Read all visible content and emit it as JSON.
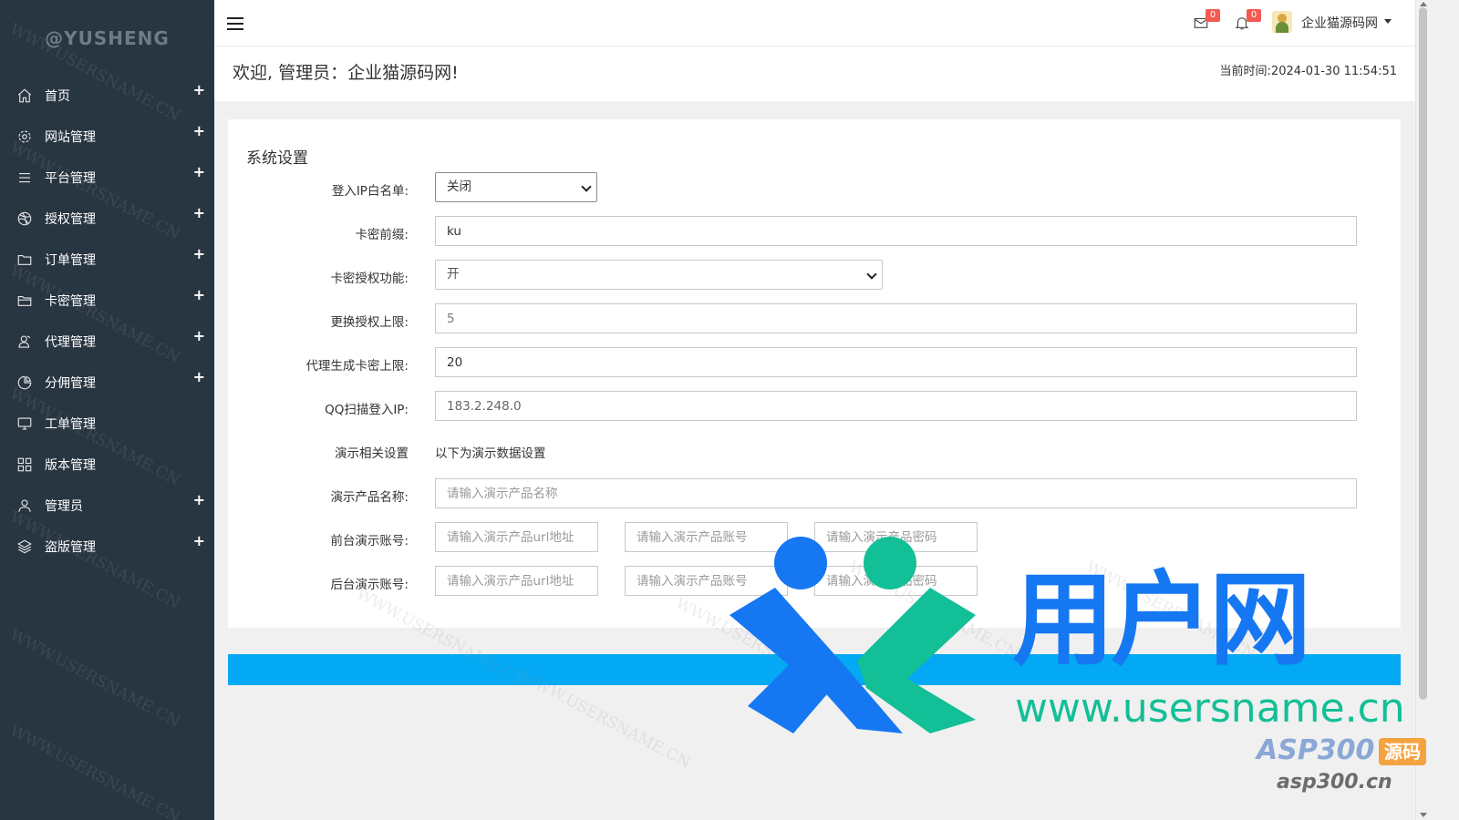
{
  "sidebar": {
    "brand": "@YUSHENG",
    "items": [
      {
        "label": "首页",
        "icon": "home-icon",
        "expandable": true
      },
      {
        "label": "网站管理",
        "icon": "gear-icon",
        "expandable": true
      },
      {
        "label": "平台管理",
        "icon": "list-icon",
        "expandable": true
      },
      {
        "label": "授权管理",
        "icon": "dribbble-icon",
        "expandable": true
      },
      {
        "label": "订单管理",
        "icon": "folder-icon",
        "expandable": true
      },
      {
        "label": "卡密管理",
        "icon": "folder-open-icon",
        "expandable": true
      },
      {
        "label": "代理管理",
        "icon": "agent-icon",
        "expandable": true
      },
      {
        "label": "分佣管理",
        "icon": "pie-chart-icon",
        "expandable": true
      },
      {
        "label": "工单管理",
        "icon": "monitor-icon",
        "expandable": false
      },
      {
        "label": "版本管理",
        "icon": "grid-icon",
        "expandable": false
      },
      {
        "label": "管理员",
        "icon": "user-icon",
        "expandable": true
      },
      {
        "label": "盗版管理",
        "icon": "layers-icon",
        "expandable": true
      }
    ],
    "expand_symbol": "+"
  },
  "topbar": {
    "mail_count": "0",
    "notice_count": "0",
    "username": "企业猫源码网"
  },
  "welcome": {
    "title": "欢迎, 管理员：企业猫源码网!",
    "time": "当前时间:2024-01-30 11:54:51"
  },
  "form": {
    "title": "系统设置",
    "ip_whitelist": {
      "label": "登入IP白名单:",
      "value": "关闭"
    },
    "card_prefix": {
      "label": "卡密前缀:",
      "value": "ku"
    },
    "card_auth": {
      "label": "卡密授权功能:",
      "value": "开"
    },
    "auth_change_limit": {
      "label": "更换授权上限:",
      "value": "5"
    },
    "agent_card_limit": {
      "label": "代理生成卡密上限:",
      "value": "20"
    },
    "qq_scan_ip": {
      "label": "QQ扫描登入IP:",
      "value": "183.2.248.0"
    },
    "demo_settings": {
      "label": "演示相关设置",
      "text": "以下为演示数据设置"
    },
    "demo_product_name": {
      "label": "演示产品名称:",
      "placeholder": "请输入演示产品名称"
    },
    "front_demo": {
      "label": "前台演示账号:",
      "url_placeholder": "请输入演示产品url地址",
      "account_placeholder": "请输入演示产品账号",
      "password_placeholder": "请输入演示产品密码"
    },
    "back_demo": {
      "label": "后台演示账号:",
      "url_placeholder": "请输入演示产品url地址",
      "account_placeholder": "请输入演示产品账号",
      "password_placeholder": "请输入演示产品密码"
    }
  },
  "watermark": {
    "repeat_text": "WWW.USERSNAME.CN",
    "logo_text": "用户网",
    "logo_url": "www.usersname.cn",
    "asp_brand": "ASP300",
    "asp_tag": "源码",
    "asp_url": "asp300.cn"
  },
  "colors": {
    "sidebar_bg": "#283642",
    "accent_blue": "#03a9f4",
    "badge_red": "#f25a52",
    "logo_blue": "#1677f2",
    "logo_green": "#13bf96"
  }
}
